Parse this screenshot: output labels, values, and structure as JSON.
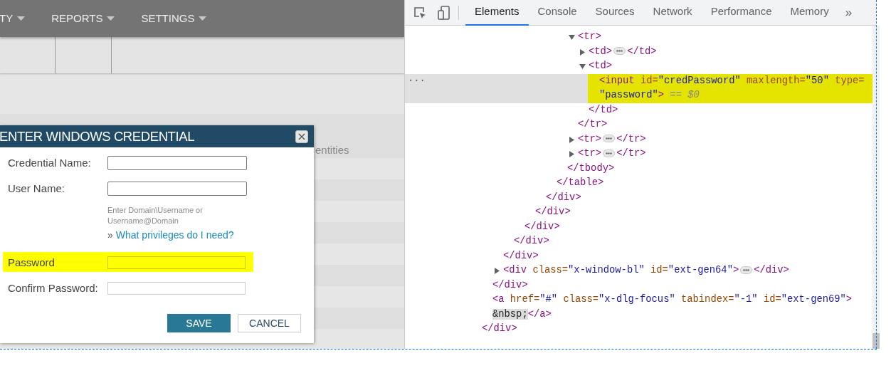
{
  "app": {
    "nav": [
      {
        "label": "TY"
      },
      {
        "label": "REPORTS"
      },
      {
        "label": "SETTINGS"
      }
    ],
    "background_text": "entities",
    "dialog": {
      "title": "ENTER WINDOWS CREDENTIAL",
      "fields": [
        {
          "label": "Credential Name:",
          "highlighted": false
        },
        {
          "label": "User Name:",
          "highlighted": false,
          "hint": "Enter Domain\\Username or Username@Domain",
          "link_prefix": "»",
          "link": "What privileges do I need?"
        },
        {
          "label": "Password",
          "highlighted": true
        },
        {
          "label": "Confirm Password:",
          "highlighted": false
        }
      ],
      "buttons": [
        {
          "label": "SAVE",
          "kind": "primary"
        },
        {
          "label": "CANCEL",
          "kind": "secondary"
        }
      ]
    }
  },
  "devtools": {
    "tabs": [
      {
        "label": "Elements",
        "selected": true
      },
      {
        "label": "Console",
        "selected": false
      },
      {
        "label": "Sources",
        "selected": false
      },
      {
        "label": "Network",
        "selected": false
      },
      {
        "label": "Performance",
        "selected": false
      },
      {
        "label": "Memory",
        "selected": false
      }
    ],
    "overflow": "»",
    "selected_marker": "···",
    "tree": {
      "close": "</div>",
      "children": [
        {
          "close": "</div>",
          "children": [
            {
              "close": "</div>",
              "children": [
                {
                  "close": "</div>",
                  "children": [
                    {
                      "close": "</div>",
                      "children": [
                        {
                          "close": "</div>",
                          "children": [
                            {
                              "close": "</div>",
                              "children": [
                                {
                                  "close": "</table>",
                                  "children": [
                                    {
                                      "close": "</tbody>",
                                      "children": [
                                        {
                                          "open": [
                                            {
                                              "kind": "tag",
                                              "text": "<tr>"
                                            }
                                          ],
                                          "expanded": true,
                                          "close": "</tr>",
                                          "children": [
                                            {
                                              "open": [
                                                {
                                                  "kind": "tag",
                                                  "text": "<td>"
                                                }
                                              ],
                                              "expanded": false,
                                              "close": "</td>"
                                            },
                                            {
                                              "open": [
                                                {
                                                  "kind": "tag",
                                                  "text": "<td>"
                                                }
                                              ],
                                              "expanded": true,
                                              "close": "</td>",
                                              "children": [
                                                {
                                                  "open": [
                                                    {
                                                      "kind": "tag",
                                                      "text": "<input"
                                                    },
                                                    {
                                                      "kind": "attr",
                                                      "text": "id="
                                                    },
                                                    {
                                                      "kind": "value",
                                                      "text": "\"credPassword\""
                                                    },
                                                    {
                                                      "kind": "attr",
                                                      "text": "maxlength="
                                                    },
                                                    {
                                                      "kind": "value",
                                                      "text": "\"50\""
                                                    },
                                                    {
                                                      "kind": "attr",
                                                      "text": "type="
                                                    },
                                                    {
                                                      "kind": "value",
                                                      "text": "\"password\""
                                                    },
                                                    {
                                                      "kind": "tag",
                                                      "text": ">"
                                                    }
                                                  ],
                                                  "suffix": "== $0",
                                                  "selected": true,
                                                  "highlighted": true
                                                }
                                              ]
                                            }
                                          ]
                                        },
                                        {
                                          "open": [
                                            {
                                              "kind": "tag",
                                              "text": "<tr>"
                                            }
                                          ],
                                          "expanded": false,
                                          "close": "</tr>"
                                        },
                                        {
                                          "open": [
                                            {
                                              "kind": "tag",
                                              "text": "<tr>"
                                            }
                                          ],
                                          "expanded": false,
                                          "close": "</tr>"
                                        }
                                      ]
                                    }
                                  ]
                                }
                              ]
                            }
                          ]
                        }
                      ]
                    }
                  ]
                }
              ]
            },
            {
              "open": [
                {
                  "kind": "tag",
                  "text": "<div"
                },
                {
                  "kind": "attr",
                  "text": "class="
                },
                {
                  "kind": "value",
                  "text": "\"x-window-bl\""
                },
                {
                  "kind": "attr",
                  "text": "id="
                },
                {
                  "kind": "value",
                  "text": "\"ext-gen64\""
                },
                {
                  "kind": "tag",
                  "text": ">"
                }
              ],
              "expanded": false,
              "close": "</div>"
            }
          ]
        },
        {
          "open": [
            {
              "kind": "tag",
              "text": "<a"
            },
            {
              "kind": "attr",
              "text": "href="
            },
            {
              "kind": "value",
              "text": "\"#\""
            },
            {
              "kind": "attr",
              "text": "class="
            },
            {
              "kind": "value",
              "text": "\"x-dlg-focus\""
            },
            {
              "kind": "attr",
              "text": "tabindex="
            },
            {
              "kind": "value",
              "text": "\"-1\""
            },
            {
              "kind": "attr",
              "text": "id="
            },
            {
              "kind": "value",
              "text": "\"ext-gen69\""
            },
            {
              "kind": "tag",
              "text": ">"
            }
          ],
          "text": "&nbsp;",
          "close": "</a>"
        }
      ]
    }
  }
}
